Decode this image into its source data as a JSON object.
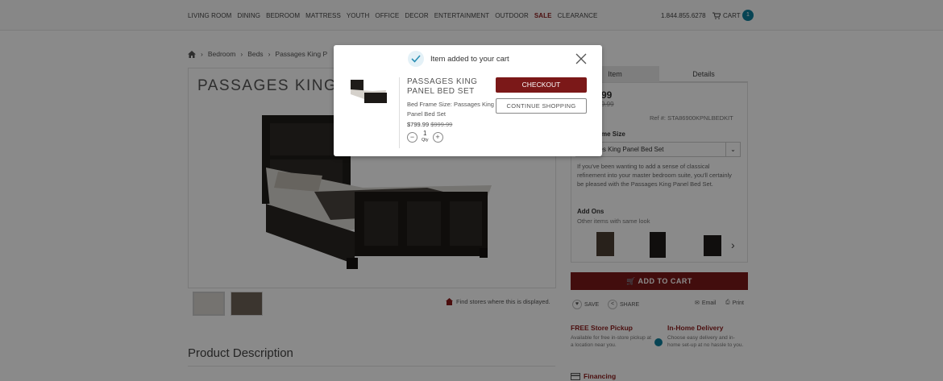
{
  "nav": {
    "items": [
      "LIVING ROOM",
      "DINING",
      "BEDROOM",
      "MATTRESS",
      "YOUTH",
      "OFFICE",
      "DECOR",
      "ENTERTAINMENT",
      "OUTDOOR"
    ],
    "sale": "SALE",
    "clearance": "CLEARANCE",
    "phone": "1.844.855.6278",
    "cart_label": "CART",
    "cart_count": "1"
  },
  "breadcrumb": [
    "Bedroom",
    "Beds",
    "Passages King P"
  ],
  "product": {
    "title": "PASSAGES KING P",
    "find_stores": "Find stores where this is displayed.",
    "description_heading": "Product Description"
  },
  "right": {
    "tab_item": "Item",
    "tab_details": "Details",
    "price": "99",
    "old_price": "9.99",
    "ref": "Ref #: STA86900KPNLBEDKIT",
    "frame_label": "me Size",
    "frame_value": "ges King Panel Bed Set",
    "blurb": "If you've been wanting to add a sense of classical refinement into your master bedroom suite, you'll certainly be pleased with the Passages King Panel Bed Set.",
    "addons_title": "Add Ons",
    "addons_sub": "Other items with same look",
    "add_to_cart": "ADD TO CART",
    "save": "SAVE",
    "share": "SHARE",
    "email": "Email",
    "print": "Print",
    "pickup_title": "FREE Store Pickup",
    "pickup_text": "Available for free in-store pickup at a location near you.",
    "delivery_title": "In-Home Delivery",
    "delivery_text": "Choose easy delivery and in-home set-up at no hassle to you.",
    "financing": "Financing"
  },
  "modal": {
    "title": "Item added to your cart",
    "name": "PASSAGES KING PANEL BED SET",
    "frame": "Bed Frame Size: Passages King Panel Bed Set",
    "price": "$799.99",
    "old_price": "$999.99",
    "qty": "1",
    "qty_label": "Qty",
    "checkout": "CHECKOUT",
    "continue": "CONTINUE SHOPPING"
  },
  "colors": {
    "brand_red": "#7b1818",
    "accent_teal": "#0e7f9c"
  }
}
